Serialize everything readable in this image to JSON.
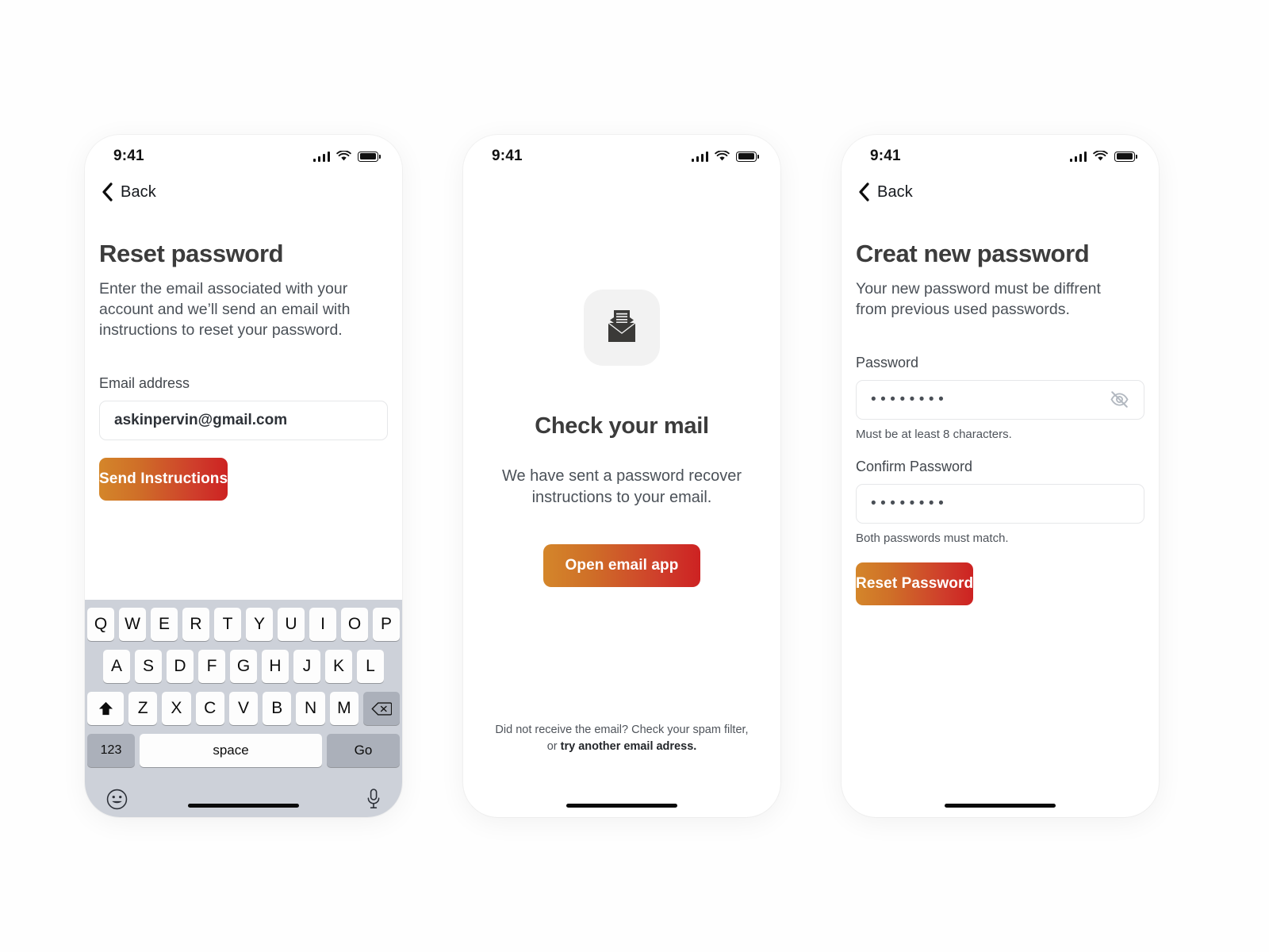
{
  "theme": {
    "gradient_start": "#d4862a",
    "gradient_end": "#cd2222",
    "text_dark": "#3c3c3c",
    "text_body": "#4b5158",
    "keyboard_bg": "#cdd1d9"
  },
  "screens": [
    {
      "id": "reset-password",
      "status": {
        "time": "9:41"
      },
      "back_label": "Back",
      "title": "Reset password",
      "subtitle": "Enter the email associated with your account and we’ll send an email with instructions to reset your password.",
      "email_label": "Email address",
      "email_value": "askinpervin@gmail.com",
      "email_placeholder": "Email address",
      "submit_label": "Send Instructions",
      "keyboard": {
        "row1": [
          "Q",
          "W",
          "E",
          "R",
          "T",
          "Y",
          "U",
          "I",
          "O",
          "P"
        ],
        "row2": [
          "A",
          "S",
          "D",
          "F",
          "G",
          "H",
          "J",
          "K",
          "L"
        ],
        "row3": [
          "Z",
          "X",
          "C",
          "V",
          "B",
          "N",
          "M"
        ],
        "shift_icon": "shift-icon",
        "backspace_icon": "backspace-icon",
        "numeric_label": "123",
        "space_label": "space",
        "return_label": "Go",
        "emoji_icon": "emoji-icon",
        "mic_icon": "microphone-icon"
      }
    },
    {
      "id": "check-mail",
      "status": {
        "time": "9:41"
      },
      "icon": "open-envelope-icon",
      "title": "Check your mail",
      "subtitle": "We have sent a password recover instructions to your email.",
      "button_label": "Open email app",
      "footer_line1": "Did not receive the email? Check your spam filter,",
      "footer_prefix": "or ",
      "footer_link": "try another email adress."
    },
    {
      "id": "create-new-password",
      "status": {
        "time": "9:41"
      },
      "back_label": "Back",
      "title": "Creat new password",
      "subtitle": "Your new password must be diffrent from previous used passwords.",
      "password_label": "Password",
      "password_value": "••••••••",
      "password_hint": "Must be at least 8 characters.",
      "toggle_icon": "eye-off-icon",
      "confirm_label": "Confirm Password",
      "confirm_value": "••••••••",
      "confirm_hint": "Both passwords must match.",
      "submit_label": "Reset Password"
    }
  ]
}
